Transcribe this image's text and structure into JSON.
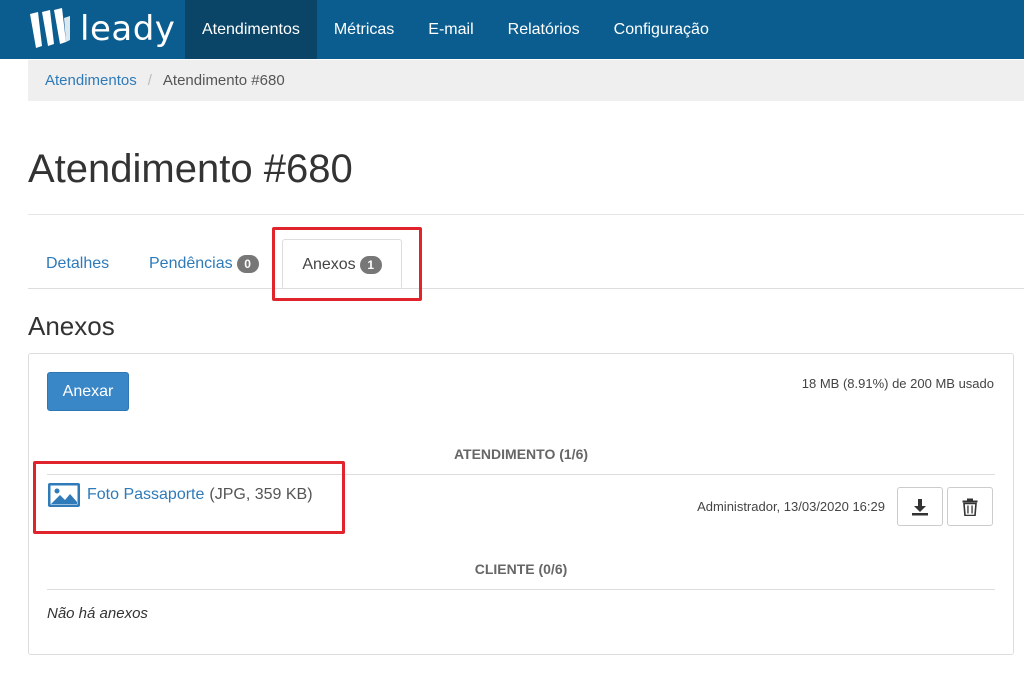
{
  "header": {
    "logo_text": "leady",
    "nav": [
      {
        "label": "Atendimentos",
        "active": true
      },
      {
        "label": "Métricas"
      },
      {
        "label": "E-mail"
      },
      {
        "label": "Relatórios"
      },
      {
        "label": "Configuração"
      }
    ]
  },
  "breadcrumb": {
    "parent": "Atendimentos",
    "separator": "/",
    "current": "Atendimento #680"
  },
  "page_title": "Atendimento #680",
  "tabs": [
    {
      "label": "Detalhes"
    },
    {
      "label": "Pendências",
      "badge": "0"
    },
    {
      "label": "Anexos",
      "badge": "1",
      "active": true
    }
  ],
  "section_title": "Anexos",
  "panel": {
    "attach_button": "Anexar",
    "usage": "18 MB (8.91%) de 200 MB usado",
    "groups": [
      {
        "header": "ATENDIMENTO (1/6)",
        "files": [
          {
            "name": "Foto Passaporte",
            "meta": "(JPG, 359 KB)",
            "author": "Administrador, 13/03/2020 16:29"
          }
        ]
      },
      {
        "header": "CLIENTE (0/6)",
        "empty": "Não há anexos"
      }
    ]
  },
  "colors": {
    "navbar": "#0c5d8f",
    "nav_active": "#0a4466",
    "link": "#2f7ab8",
    "primary_button": "#3a87c8",
    "highlight": "#e0242c"
  },
  "icons": [
    "logo-mark-icon",
    "image-file-icon",
    "download-icon",
    "trash-icon"
  ]
}
